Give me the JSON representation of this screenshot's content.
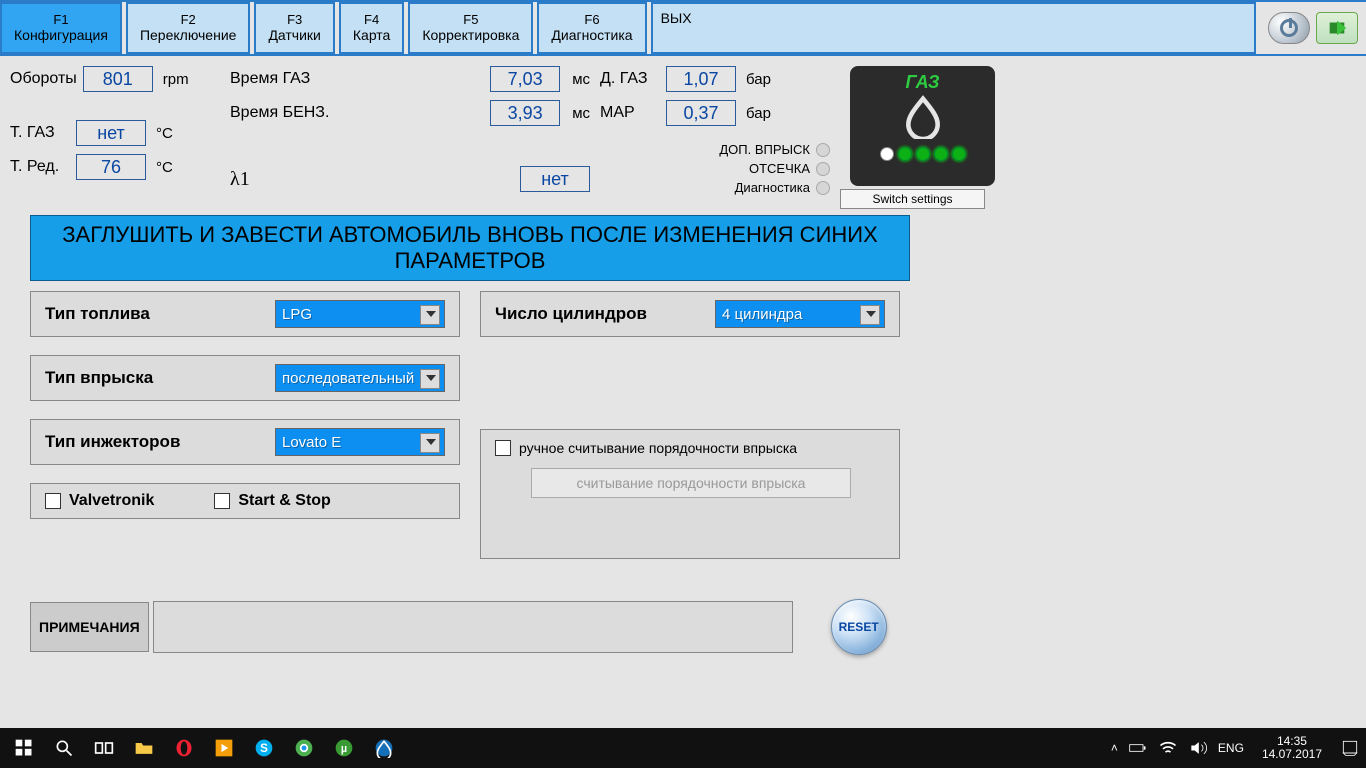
{
  "tabs": {
    "f1": {
      "key": "F1",
      "label": "Конфигурация"
    },
    "f2": {
      "key": "F2",
      "label": "Переключение"
    },
    "f3": {
      "key": "F3",
      "label": "Датчики"
    },
    "f4": {
      "key": "F4",
      "label": "Карта"
    },
    "f5": {
      "key": "F5",
      "label": "Корректировка"
    },
    "f6": {
      "key": "F6",
      "label": "Диагностика"
    },
    "exit": "ВЫХ"
  },
  "dash": {
    "rpm_label": "Обороты",
    "rpm_value": "801",
    "rpm_unit": "rpm",
    "tgas_label": "Т. ГАЗ",
    "tgas_value": "нет",
    "tred_label": "Т. Ред.",
    "tred_value": "76",
    "deg_unit": "°C",
    "time_gas_label": "Время ГАЗ",
    "time_gas_value": "7,03",
    "time_benz_label": "Время БЕНЗ.",
    "time_benz_value": "3,93",
    "ms_unit": "мс",
    "lambda_label": "λ1",
    "lambda_value": "нет",
    "dgas_label": "Д. ГАЗ",
    "dgas_value": "1,07",
    "map_label": "MAP",
    "map_value": "0,37",
    "bar_unit": "бар",
    "status_dop": "ДОП. ВПРЫСК",
    "status_cut": "ОТСЕЧКА",
    "status_diag": "Диагностика",
    "gas_title": "ГАЗ",
    "switch_btn": "Switch settings"
  },
  "banner": "ЗАГЛУШИТЬ И ЗАВЕСТИ АВТОМОБИЛЬ ВНОВЬ ПОСЛЕ ИЗМЕНЕНИЯ СИНИХ ПАРАМЕТРОВ",
  "config": {
    "fuel_type_label": "Тип топлива",
    "fuel_type_value": "LPG",
    "inj_type_label": "Тип впрыска",
    "inj_type_value": "последовательный",
    "injector_label": "Тип инжекторов",
    "injector_value": "Lovato E",
    "cyl_label": "Число цилиндров",
    "cyl_value": "4 цилиндра",
    "valvetronik": "Valvetronik",
    "startstop": "Start & Stop",
    "manual_chk": "ручное считывание порядочности впрыска",
    "manual_btn": "считывание порядочности впрыска"
  },
  "notes_label": "ПРИМЕЧАНИЯ",
  "reset": "RESET",
  "taskbar": {
    "lang": "ENG",
    "time": "14:35",
    "date": "14.07.2017"
  }
}
